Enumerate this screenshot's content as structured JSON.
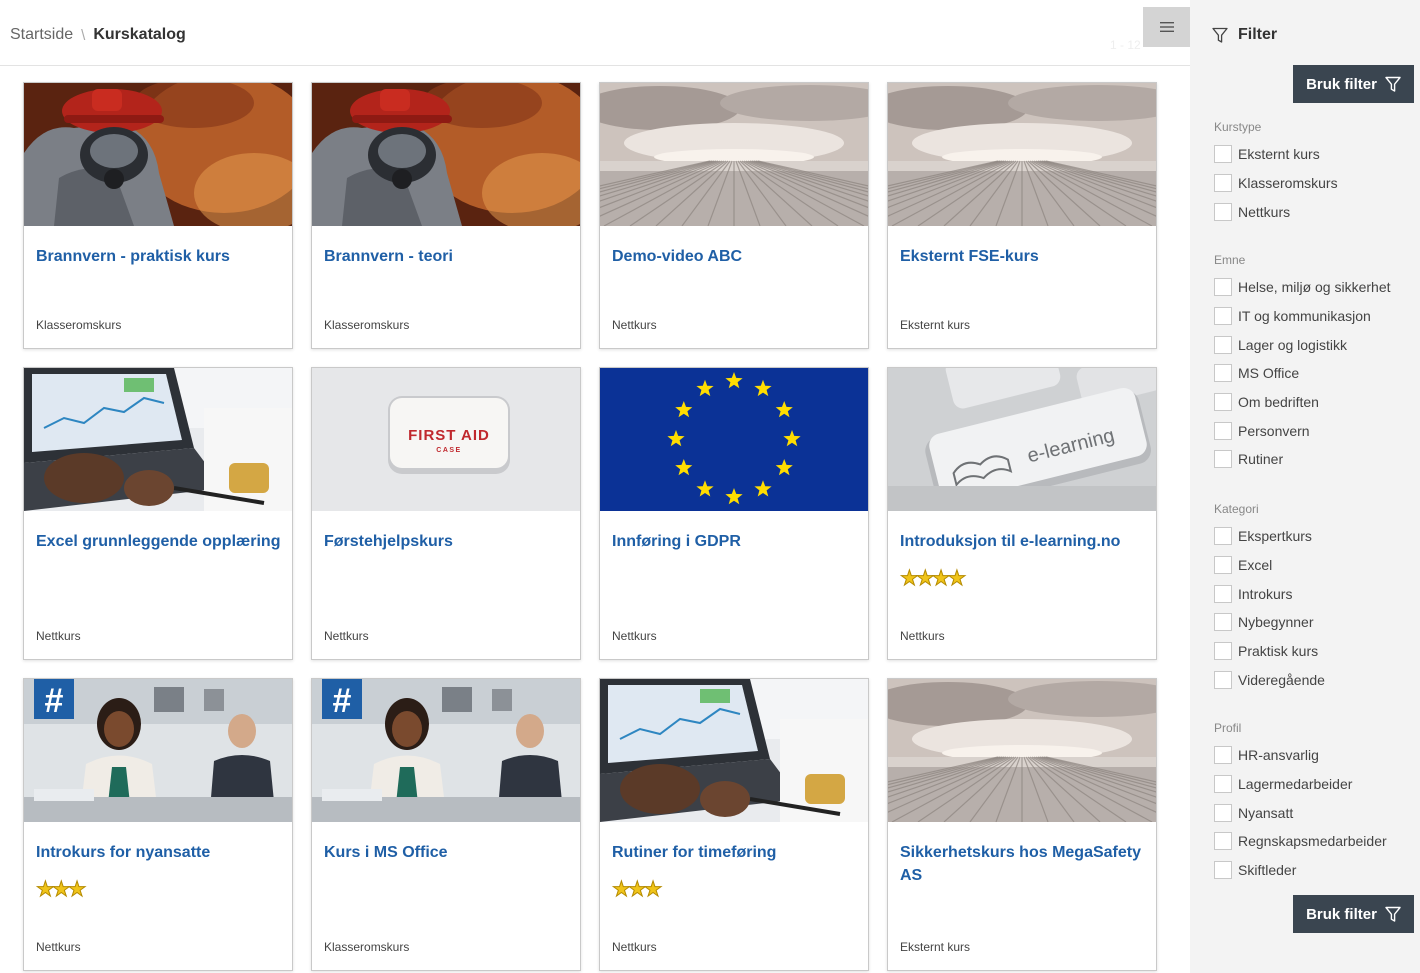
{
  "breadcrumb": {
    "home": "Startside",
    "separator": "\\",
    "current": "Kurskatalog"
  },
  "page_indicator": "1 - 12",
  "icons": {
    "menu": "hamburger-menu-icon",
    "filter": "filter-funnel-icon"
  },
  "colors": {
    "title_link": "#1f5fa6",
    "apply_button": "#3a4550",
    "star": "#f0c419",
    "sidebar_bg": "#f3f3f3"
  },
  "courses": [
    {
      "title": "Brannvern - praktisk kurs",
      "type": "Klasseromskurs",
      "image": "firefighter"
    },
    {
      "title": "Brannvern - teori",
      "type": "Klasseromskurs",
      "image": "firefighter"
    },
    {
      "title": "Demo-video ABC",
      "type": "Nettkurs",
      "image": "sky-pier"
    },
    {
      "title": "Eksternt FSE-kurs",
      "type": "Eksternt kurs",
      "image": "sky-pier"
    },
    {
      "title": "Excel grunnleggende opplæring",
      "type": "Nettkurs",
      "image": "laptop-charts"
    },
    {
      "title": "Førstehjelpskurs",
      "type": "Nettkurs",
      "image": "first-aid-case"
    },
    {
      "title": "Innføring i GDPR",
      "type": "Nettkurs",
      "image": "eu-flag"
    },
    {
      "title": "Introduksjon til e-learning.no",
      "type": "Nettkurs",
      "image": "e-learning-key",
      "rating": "★★★★",
      "rating_value": 4
    },
    {
      "title": "Introkurs for nyansatte",
      "type": "Nettkurs",
      "image": "office-meeting",
      "rating": "★★★",
      "rating_value": 3
    },
    {
      "title": "Kurs i MS Office",
      "type": "Klasseromskurs",
      "image": "office-meeting"
    },
    {
      "title": "Rutiner for timeføring",
      "type": "Nettkurs",
      "image": "laptop-charts",
      "rating": "★★★",
      "rating_value": 3
    },
    {
      "title": "Sikkerhetskurs hos MegaSafety AS",
      "type": "Eksternt kurs",
      "image": "sky-pier"
    }
  ],
  "image_text": {
    "first_aid": "FIRST AID",
    "first_aid_sub": "CASE",
    "elearning": "e-learning"
  },
  "filter": {
    "heading": "Filter",
    "apply_label": "Bruk filter",
    "groups": [
      {
        "title": "Kurstype",
        "options": [
          "Eksternt kurs",
          "Klasseromskurs",
          "Nettkurs"
        ]
      },
      {
        "title": "Emne",
        "options": [
          "Helse, miljø og sikkerhet",
          "IT og kommunikasjon",
          "Lager og logistikk",
          "MS Office",
          "Om bedriften",
          "Personvern",
          "Rutiner"
        ]
      },
      {
        "title": "Kategori",
        "options": [
          "Ekspertkurs",
          "Excel",
          "Introkurs",
          "Nybegynner",
          "Praktisk kurs",
          "Videregående"
        ]
      },
      {
        "title": "Profil",
        "options": [
          "HR-ansvarlig",
          "Lagermedarbeider",
          "Nyansatt",
          "Regnskapsmedarbeider",
          "Skiftleder"
        ]
      }
    ]
  }
}
